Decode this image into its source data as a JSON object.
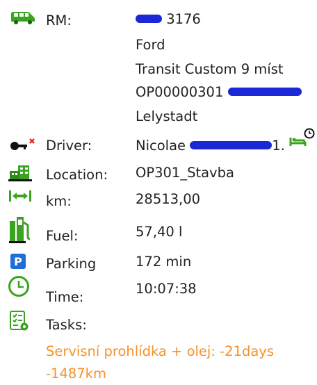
{
  "vehicle": {
    "label": "RM:",
    "plate_suffix": "3176",
    "make": "Ford",
    "model": "Transit Custom 9 míst",
    "code": "OP00000301",
    "location_city": "Lelystadt"
  },
  "driver": {
    "label": "Driver:",
    "name": "Nicolae",
    "suffix": "1."
  },
  "location": {
    "label": "Location:",
    "value": "OP301_Stavba"
  },
  "km": {
    "label": "km:",
    "value": "28513,00"
  },
  "fuel": {
    "label": "Fuel:",
    "value": "57,40 l"
  },
  "parking": {
    "label": "Parking",
    "value": "172 min"
  },
  "time": {
    "label": "Time:",
    "value": "10:07:38"
  },
  "tasks": {
    "label": "Tasks:",
    "alert_line1": "Servisní prohlídka + olej: -21days",
    "alert_line2": "-1487km"
  },
  "colors": {
    "icon_green": "#3aa31f",
    "parking_blue": "#1e6fd6",
    "alert_orange": "#f5922a",
    "redaction_blue": "#1a28d6",
    "text": "#222222"
  },
  "icons": {
    "vehicle": "van-icon",
    "driver": "key-icon",
    "driver_status": "bed-clock-icon",
    "location": "building-icon",
    "km": "distance-arrows-icon",
    "fuel": "fuel-pump-icon",
    "parking": "parking-icon",
    "time": "clock-icon",
    "tasks": "task-list-icon"
  }
}
